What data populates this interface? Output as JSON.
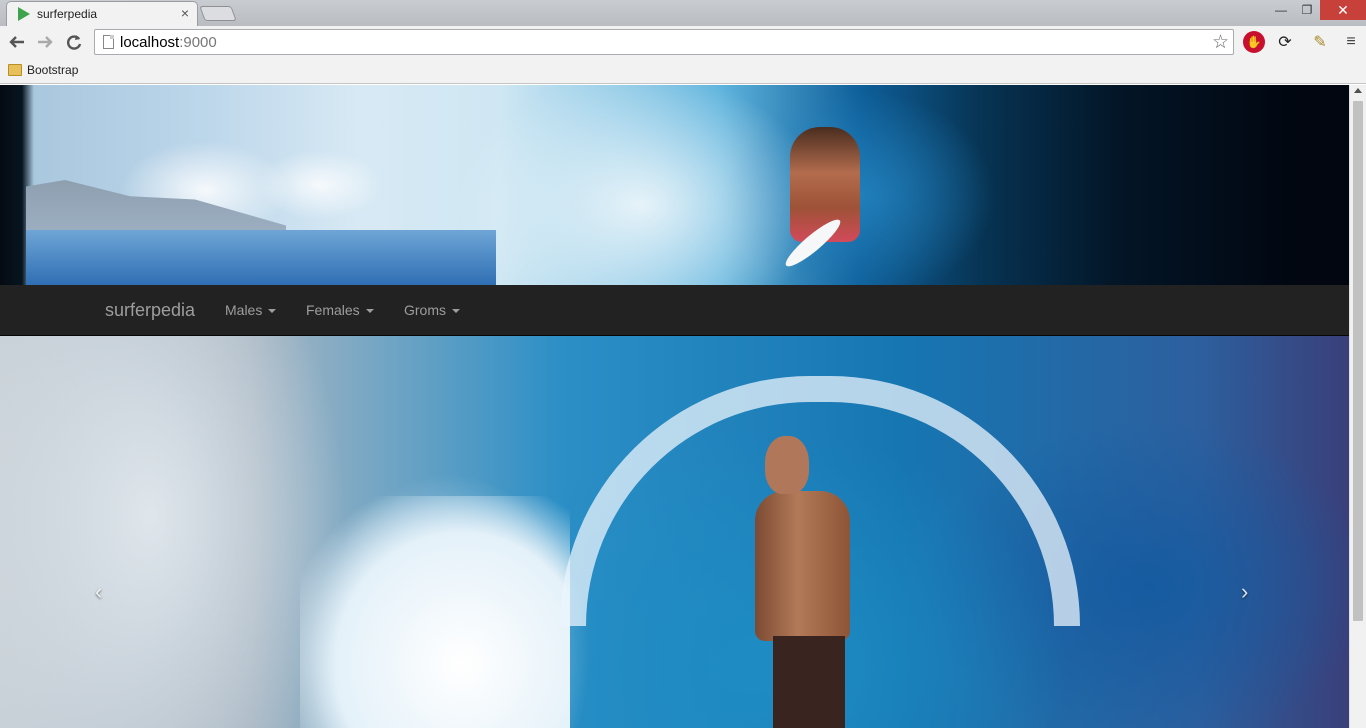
{
  "browser": {
    "tab_title": "surferpedia",
    "tab_close": "×",
    "url_host": "localhost",
    "url_port": ":9000",
    "bookmark": "Bootstrap",
    "icons": {
      "back": "back-arrow-icon",
      "forward": "forward-arrow-icon",
      "reload": "reload-icon",
      "star": "bookmark-star-icon",
      "menu": "hamburger-menu-icon"
    }
  },
  "navbar": {
    "brand": "surferpedia",
    "items": [
      {
        "label": "Males"
      },
      {
        "label": "Females"
      },
      {
        "label": "Groms"
      }
    ]
  },
  "carousel": {
    "prev": "‹",
    "next": "›"
  },
  "colors": {
    "navbar_bg": "#222222",
    "navbar_text": "#9d9d9d",
    "chrome_bg": "#f2f2f2",
    "close_button": "#c7403a"
  }
}
